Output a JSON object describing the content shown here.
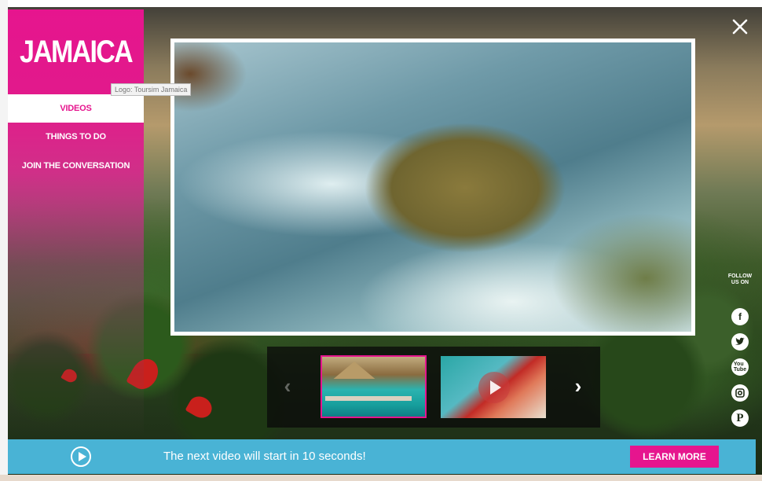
{
  "brand": {
    "name": "JAMAICA",
    "logo_tooltip": "Logo: Toursim Jamaica"
  },
  "nav": {
    "items": [
      {
        "label": "VIDEOS",
        "active": true
      },
      {
        "label": "THINGS TO DO",
        "active": false
      },
      {
        "label": "JOIN THE CONVERSATION",
        "active": false
      }
    ]
  },
  "close": {
    "icon": "close-icon"
  },
  "thumbnails": {
    "prev_icon": "chevron-left-icon",
    "next_icon": "chevron-right-icon",
    "items": [
      {
        "selected": true
      },
      {
        "selected": false,
        "has_play_icon": true
      }
    ]
  },
  "social": {
    "heading_line1": "FOLLOW",
    "heading_line2": "US ON",
    "icons": [
      "facebook-icon",
      "twitter-icon",
      "youtube-icon",
      "instagram-icon",
      "pinterest-icon"
    ]
  },
  "bottom_bar": {
    "message": "The next video will start in 10 seconds!",
    "button_label": "LEARN MORE"
  },
  "colors": {
    "brand_pink": "#e6158e",
    "bar_blue": "#49b3d5"
  }
}
